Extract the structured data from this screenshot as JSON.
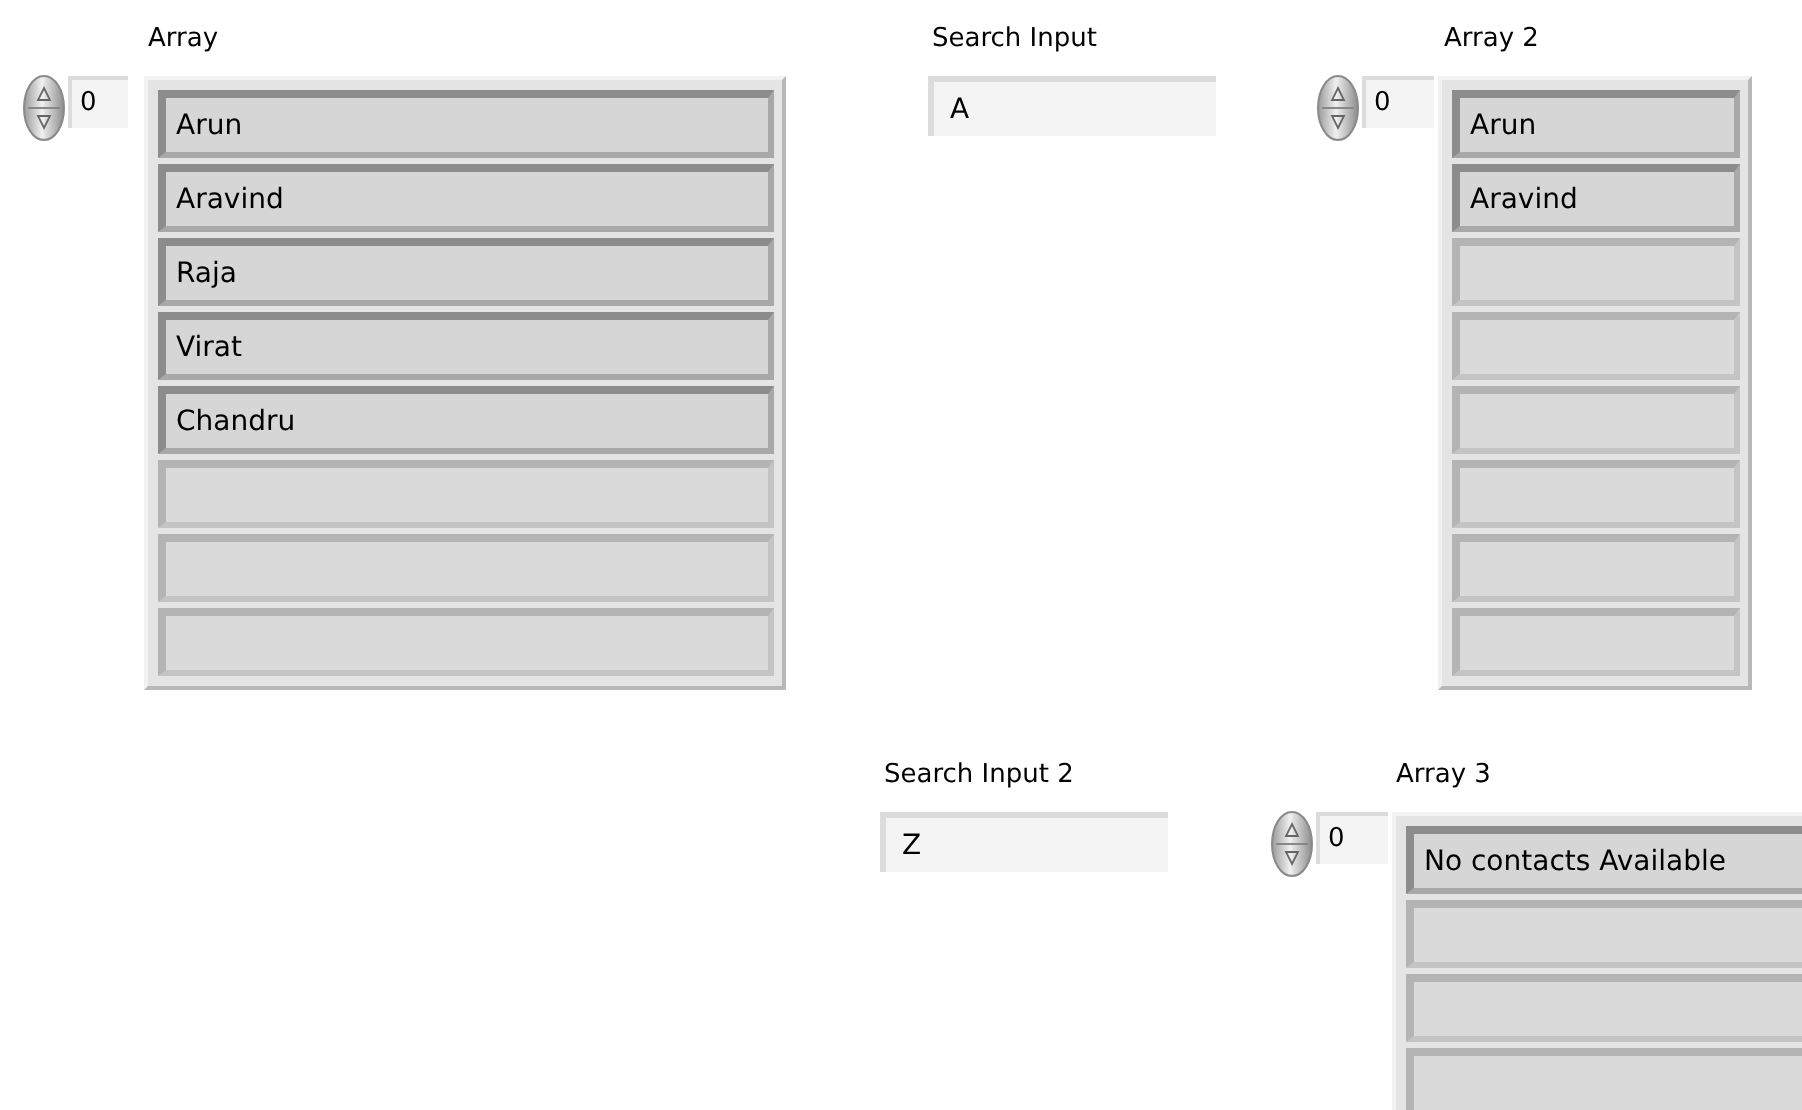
{
  "controls": [
    {
      "kind": "array",
      "label": "Array",
      "index": "0",
      "elements": [
        {
          "kind": "filled",
          "value": "Arun"
        },
        {
          "kind": "filled",
          "value": "Aravind"
        },
        {
          "kind": "filled",
          "value": "Raja"
        },
        {
          "kind": "filled",
          "value": "Virat"
        },
        {
          "kind": "filled",
          "value": "Chandru"
        },
        {
          "kind": "empty"
        },
        {
          "kind": "empty"
        },
        {
          "kind": "empty"
        }
      ]
    },
    {
      "kind": "string",
      "label": "Search Input",
      "value": "A"
    },
    {
      "kind": "array",
      "label": "Array 2",
      "index": "0",
      "elements": [
        {
          "kind": "filled",
          "value": "Arun"
        },
        {
          "kind": "filled",
          "value": "Aravind"
        },
        {
          "kind": "empty"
        },
        {
          "kind": "empty"
        },
        {
          "kind": "empty"
        },
        {
          "kind": "empty"
        },
        {
          "kind": "empty"
        },
        {
          "kind": "empty"
        }
      ]
    },
    {
      "kind": "string",
      "label": "Search Input 2",
      "value": "Z"
    },
    {
      "kind": "array",
      "label": "Array 3",
      "index": "0",
      "elements": [
        {
          "kind": "filled",
          "value": "No contacts Available"
        },
        {
          "kind": "empty"
        },
        {
          "kind": "empty"
        },
        {
          "kind": "empty"
        }
      ]
    }
  ]
}
